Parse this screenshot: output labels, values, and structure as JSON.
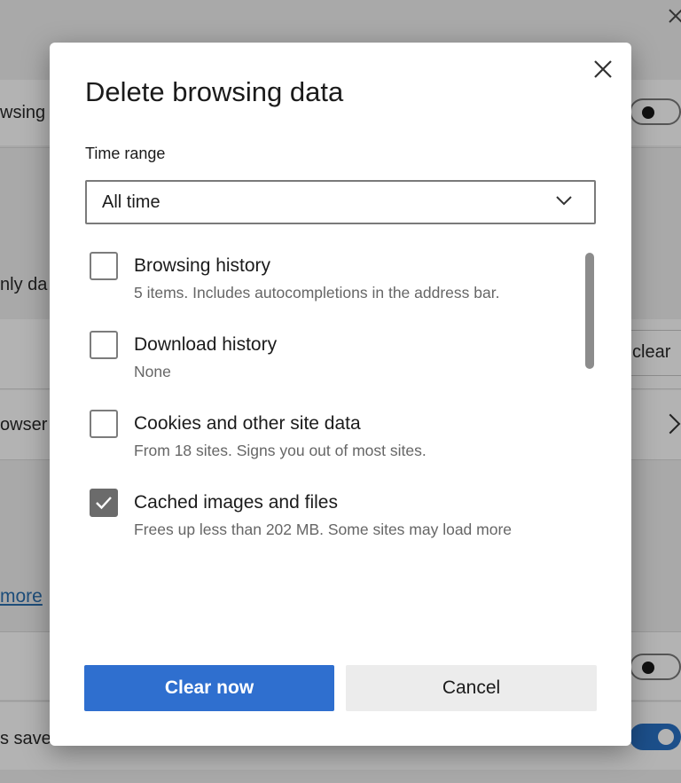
{
  "background": {
    "labels": [
      "wsing",
      "nly da",
      "owser",
      "s save"
    ],
    "clear_button_label": "clear",
    "learn_more_link": "more",
    "toggles": [
      {
        "state": "off"
      },
      {
        "state": "off"
      },
      {
        "state": "on"
      }
    ]
  },
  "dialog": {
    "title": "Delete browsing data",
    "time_range_label": "Time range",
    "time_range_value": "All time",
    "items": [
      {
        "title": "Browsing history",
        "description": "5 items. Includes autocompletions in the address bar.",
        "checked": false
      },
      {
        "title": "Download history",
        "description": "None",
        "checked": false
      },
      {
        "title": "Cookies and other site data",
        "description": "From 18 sites. Signs you out of most sites.",
        "checked": false
      },
      {
        "title": "Cached images and files",
        "description": "Frees up less than 202 MB. Some sites may load more",
        "checked": true
      }
    ],
    "primary_button": "Clear now",
    "secondary_button": "Cancel"
  },
  "colors": {
    "accent": "#2f6fcf",
    "overlay_bg": "#a9a9a9",
    "checkbox_checked": "#6b6b6b"
  },
  "icons": [
    "close-icon",
    "chevron-down-icon",
    "checkmark-icon",
    "chevron-right-icon"
  ]
}
